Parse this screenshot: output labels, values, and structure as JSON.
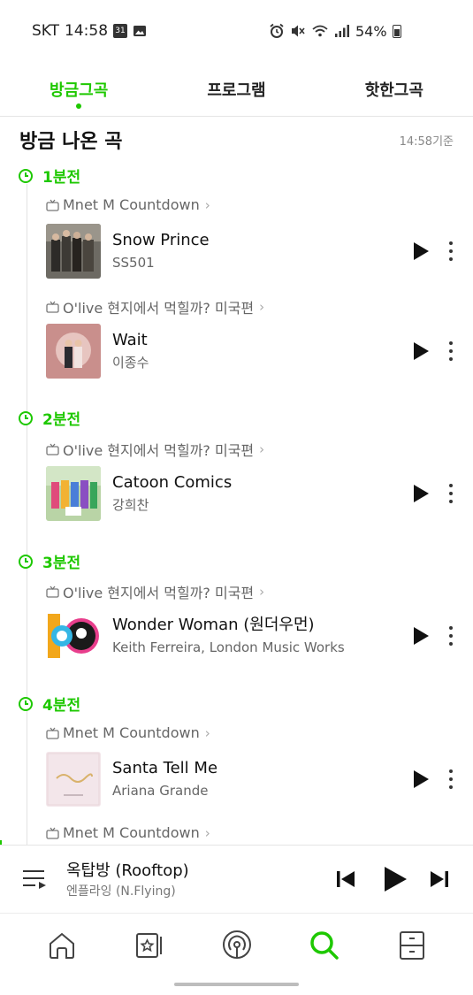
{
  "status_bar": {
    "carrier": "SKT",
    "time": "14:58",
    "calendar_badge": "31",
    "battery": "54%"
  },
  "tabs": [
    {
      "label": "방금그곡",
      "active": true
    },
    {
      "label": "프로그램",
      "active": false
    },
    {
      "label": "핫한그곡",
      "active": false
    }
  ],
  "section": {
    "title": "방금 나온 곡",
    "reference_time": "14:58기준"
  },
  "groups": [
    {
      "label": "1분전"
    },
    {
      "label": "2분전"
    },
    {
      "label": "3분전"
    },
    {
      "label": "4분전"
    }
  ],
  "programs": [
    {
      "label": "Mnet M Countdown"
    },
    {
      "label": "O'live 현지에서 먹힐까? 미국편"
    },
    {
      "label": "O'live 현지에서 먹힐까? 미국편"
    },
    {
      "label": "O'live 현지에서 먹힐까? 미국편"
    },
    {
      "label": "Mnet M Countdown"
    },
    {
      "label": "Mnet M Countdown"
    }
  ],
  "songs": [
    {
      "title": "Snow Prince",
      "artist": "SS501"
    },
    {
      "title": "Wait",
      "artist": "이종수"
    },
    {
      "title": "Catoon Comics",
      "artist": "강희찬"
    },
    {
      "title": "Wonder Woman (원더우먼)",
      "artist": "Keith Ferreira, London Music Works"
    },
    {
      "title": "Santa Tell Me",
      "artist": "Ariana Grande"
    }
  ],
  "now_playing": {
    "title": "옥탑방 (Rooftop)",
    "artist": "엔플라잉 (N.Flying)"
  },
  "colors": {
    "accent": "#1ec800",
    "text": "#111111",
    "muted": "#666666"
  },
  "icons": {
    "nav": [
      "home-icon",
      "star-card-icon",
      "podcast-icon",
      "search-icon",
      "locker-icon"
    ]
  }
}
